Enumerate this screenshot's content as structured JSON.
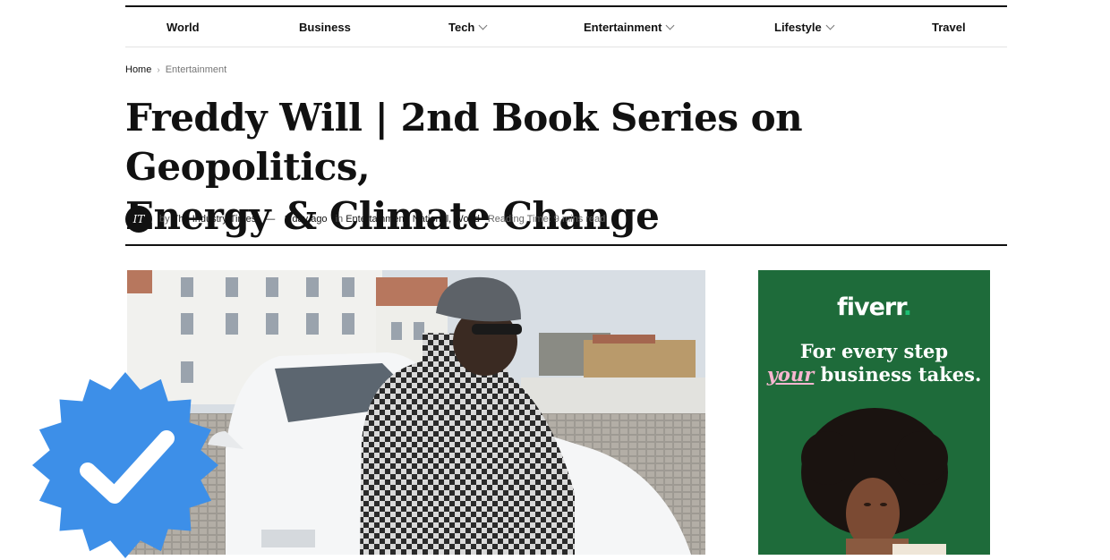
{
  "nav": {
    "items": [
      {
        "label": "World",
        "dropdown": false
      },
      {
        "label": "Business",
        "dropdown": false
      },
      {
        "label": "Tech",
        "dropdown": true
      },
      {
        "label": "Entertainment",
        "dropdown": true
      },
      {
        "label": "Lifestyle",
        "dropdown": true
      },
      {
        "label": "Travel",
        "dropdown": false
      }
    ]
  },
  "breadcrumb": {
    "home": "Home",
    "separator": "›",
    "current": "Entertainment"
  },
  "article": {
    "title_line1": "Freddy Will | 2nd Book Series on Geopolitics,",
    "title_line2": "Energy & Climate Change",
    "avatar_initials": "IT",
    "by": "by",
    "author": "The Industry Times",
    "dash": "—",
    "date": "1 day ago",
    "in": "in",
    "categories": [
      "Entertainment",
      "National",
      "World"
    ],
    "reading_time": "Reading Time: 9 mins read"
  },
  "ad": {
    "logo": "fiverr",
    "logo_dot": ".",
    "headline_line1": "For every step",
    "headline_word_accent": "your",
    "headline_line2_rest": "business takes.",
    "colors": {
      "background": "#1e6b3a",
      "accent": "#f7b6d0",
      "logo_dot": "#1dbf73"
    }
  },
  "badge": {
    "icon": "verified-check-badge",
    "color": "#3d8fe8"
  }
}
